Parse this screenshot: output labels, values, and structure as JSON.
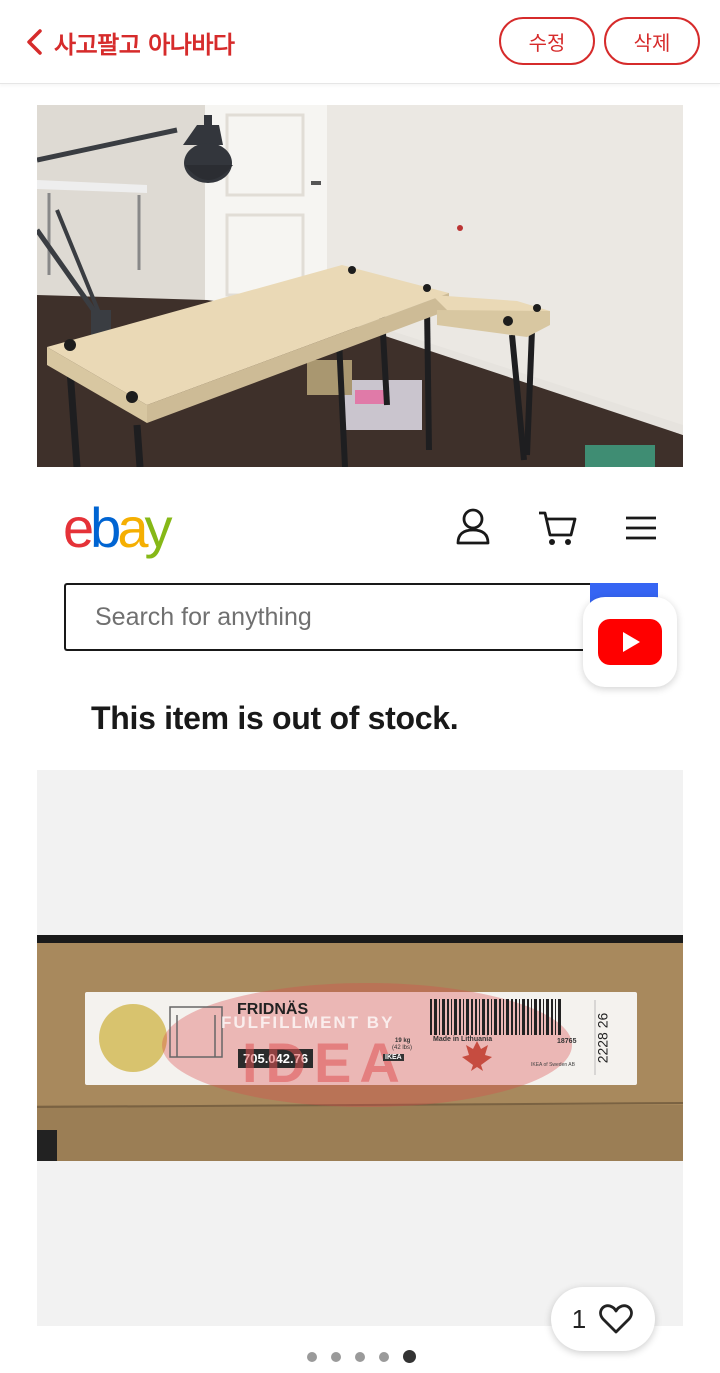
{
  "header": {
    "back_title": "사고팔고 아나바다",
    "edit_label": "수정",
    "delete_label": "삭제"
  },
  "ebay": {
    "logo_letters": [
      "e",
      "b",
      "a",
      "y"
    ],
    "logo_colors": [
      "#e53238",
      "#0064d2",
      "#f5af02",
      "#86b817"
    ],
    "search_placeholder": "Search for anything",
    "status_message": "This item is out of stock.",
    "accent": "#3665f3"
  },
  "product_label": {
    "name": "FRIDNÄS",
    "article_number": "705.042.76",
    "weight": "19 kg",
    "weight_lbs": "(42 lbs)",
    "origin": "Made in Lithuania",
    "code": "18765",
    "side_code": "2228 26",
    "brand": "IKEA",
    "supplier": "IKEA of Sweden AB",
    "watermark_top": "FULFILLMENT BY",
    "watermark_main": "IDEA"
  },
  "gallery": {
    "likes": "1",
    "total_slides": 5,
    "active_slide": 5
  },
  "colors": {
    "brand_red": "#d62b2b",
    "youtube_red": "#ff0000"
  },
  "icons": [
    "chevron-left-icon",
    "user-icon",
    "cart-icon",
    "menu-icon",
    "youtube-icon",
    "heart-icon"
  ]
}
